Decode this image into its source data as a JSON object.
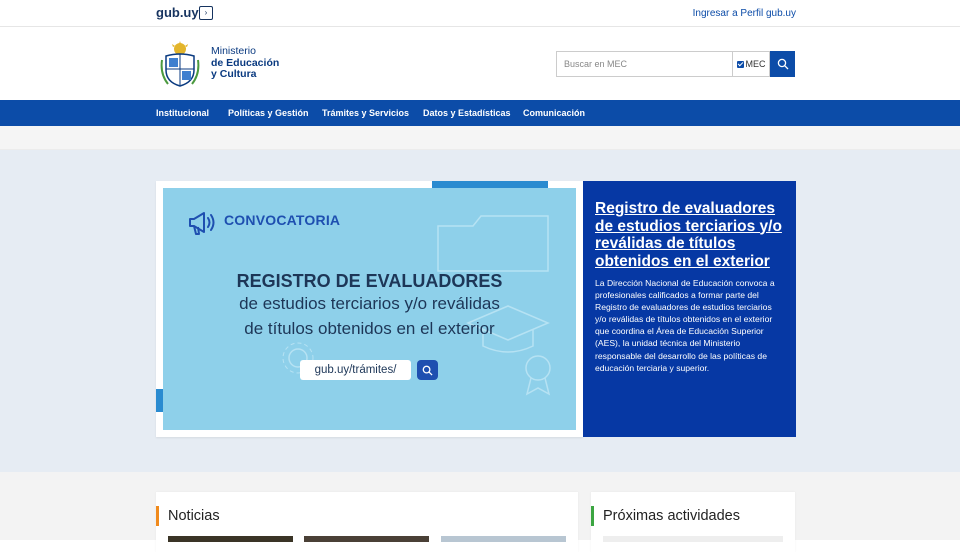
{
  "topbar": {
    "logo": "gub.uy",
    "toggle_glyph": "›",
    "perfil_link": "Ingresar a Perfil gub.uy"
  },
  "header": {
    "ministry_line1": "Ministerio",
    "ministry_line2": "de Educación",
    "ministry_line3": "y Cultura",
    "search_placeholder": "Buscar en MEC",
    "search_scope": "MEC"
  },
  "nav": {
    "items": [
      {
        "label": "Institucional"
      },
      {
        "label": "Políticas y Gestión"
      },
      {
        "label": "Trámites y Servicios"
      },
      {
        "label": "Datos y Estadísticas"
      },
      {
        "label": "Comunicación"
      }
    ]
  },
  "hero": {
    "image": {
      "tag": "CONVOCATORIA",
      "title": "REGISTRO DE EVALUADORES",
      "subtitle_line1": "de estudios terciarios y/o reválidas",
      "subtitle_line2": "de títulos obtenidos en el exterior",
      "url": "gub.uy/trámites/"
    },
    "heading": "Registro de evaluadores de estudios terciarios y/o reválidas de títulos obtenidos en el exterior",
    "body": "La Dirección Nacional de Educación convoca a profesionales calificados a formar parte del Registro de evaluadores de estudios terciarios y/o reválidas de títulos obtenidos en el exterior que coordina el Área de Educación Superior (AES), la unidad técnica del Ministerio responsable del desarrollo de las políticas de educación terciaria y superior."
  },
  "sections": {
    "news_title": "Noticias",
    "activities_title": "Próximas actividades"
  },
  "colors": {
    "brand_blue": "#0c4ca8",
    "hero_panel": "#0638a4",
    "image_bg": "#8ed0ea",
    "news_accent": "#f08a1c",
    "activities_accent": "#3ba541"
  },
  "icons": {
    "toggle": "chevron-right-icon",
    "search": "search-icon",
    "megaphone": "megaphone-icon",
    "emblem": "coat-of-arms-icon"
  }
}
